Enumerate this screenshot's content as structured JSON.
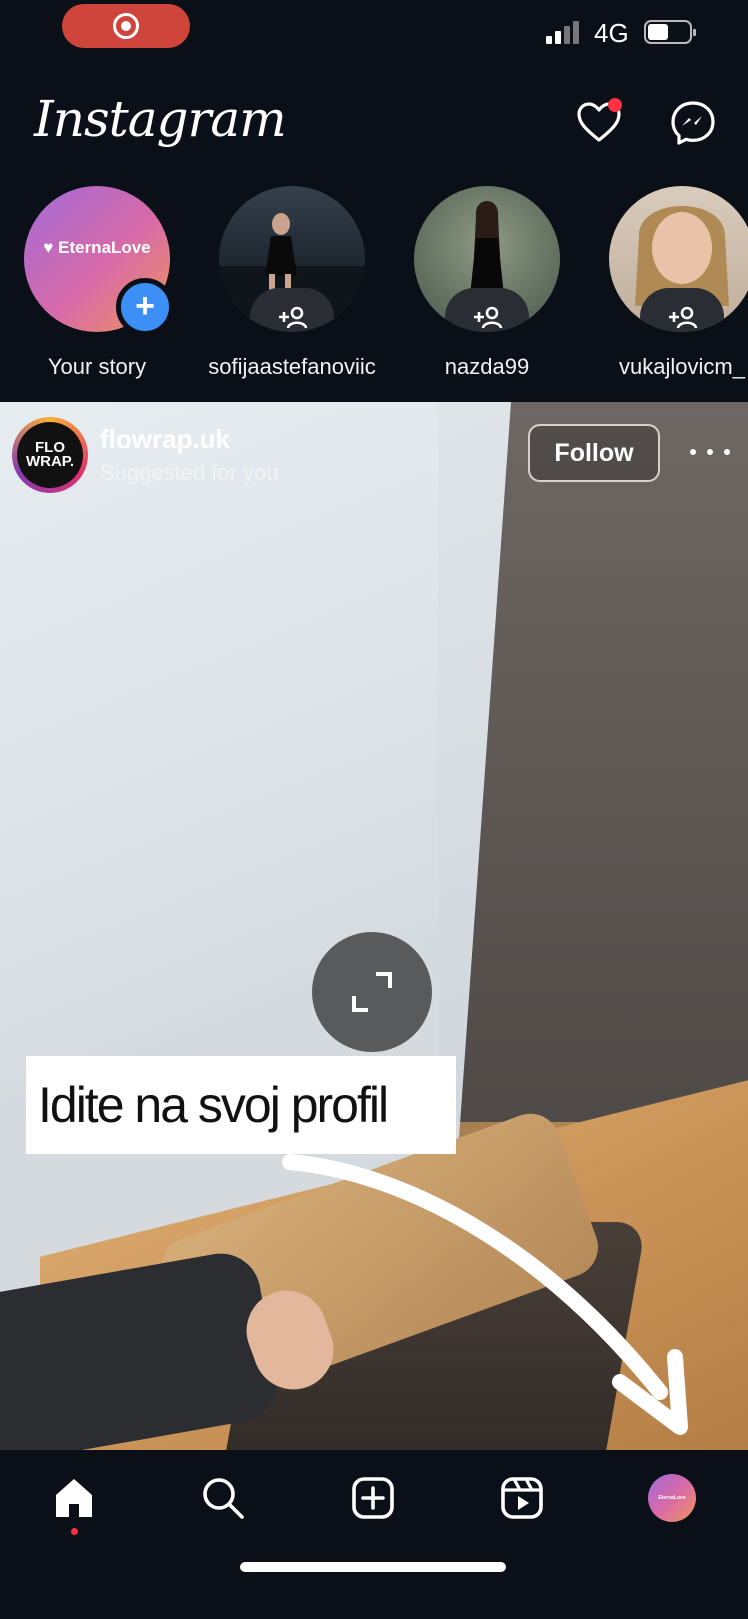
{
  "status_bar": {
    "network": "4G",
    "icons": [
      "screen-record-icon",
      "signal-icon",
      "battery-icon"
    ]
  },
  "header": {
    "logo": "Instagram",
    "icons": [
      "heart-icon",
      "messenger-icon"
    ],
    "notification_color": "#ff3040"
  },
  "stories": [
    {
      "name": "Your story",
      "avatar_text": "EternaLove",
      "badge": "+"
    },
    {
      "name": "sofijaastefanoviic"
    },
    {
      "name": "nazda99"
    },
    {
      "name": "vukajlovicm_"
    }
  ],
  "post": {
    "username": "flowrap.uk",
    "subtitle": "Suggested for you",
    "avatar_text": "FLO WRAP.",
    "follow_label": "Follow",
    "caption_overlay": "Idite na svoj profil"
  },
  "bottom_nav": {
    "items": [
      "home-icon",
      "search-icon",
      "create-icon",
      "reels-icon",
      "profile-avatar"
    ]
  },
  "colors": {
    "background": "#0b0f17",
    "story_badge": "#3b8ff5",
    "recording_pill": "#d0453b"
  }
}
